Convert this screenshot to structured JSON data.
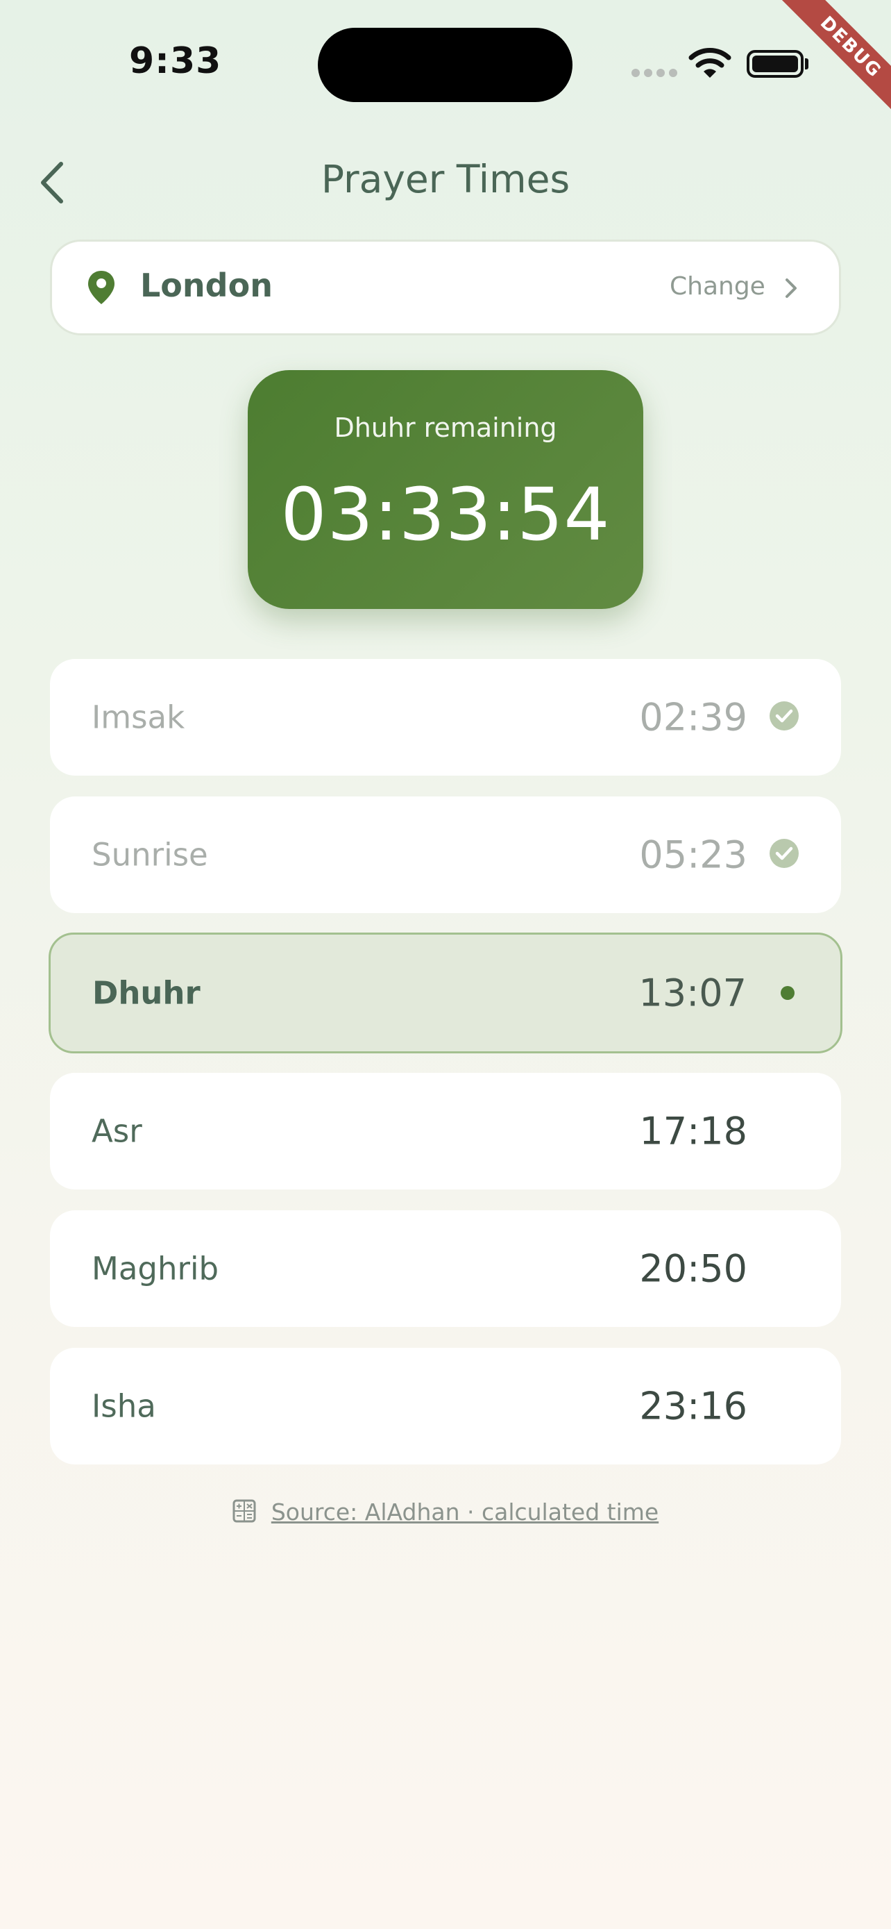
{
  "status_bar": {
    "time": "9:33",
    "debug_label": "DEBUG"
  },
  "header": {
    "title": "Prayer Times",
    "back_icon": "chevron-left-icon"
  },
  "location": {
    "name": "London",
    "change_label": "Change",
    "pin_icon": "location-pin-icon",
    "pin_color": "#4f7d33"
  },
  "countdown": {
    "label": "Dhuhr remaining",
    "time": "03:33:54",
    "bg_color": "#558535"
  },
  "prayers": [
    {
      "name": "Imsak",
      "time": "02:39",
      "state": "past",
      "icon": "check-circle-icon"
    },
    {
      "name": "Sunrise",
      "time": "05:23",
      "state": "past",
      "icon": "check-circle-icon"
    },
    {
      "name": "Dhuhr",
      "time": "13:07",
      "state": "current",
      "icon": "dot-icon"
    },
    {
      "name": "Asr",
      "time": "17:18",
      "state": "upcoming"
    },
    {
      "name": "Maghrib",
      "time": "20:50",
      "state": "upcoming"
    },
    {
      "name": "Isha",
      "time": "23:16",
      "state": "upcoming"
    }
  ],
  "source": {
    "text": "Source: AlAdhan · calculated time",
    "icon": "calculator-icon"
  },
  "colors": {
    "accent": "#4f7d33",
    "active_row_bg": "#e2e9da",
    "active_row_border": "#a3c08f"
  }
}
